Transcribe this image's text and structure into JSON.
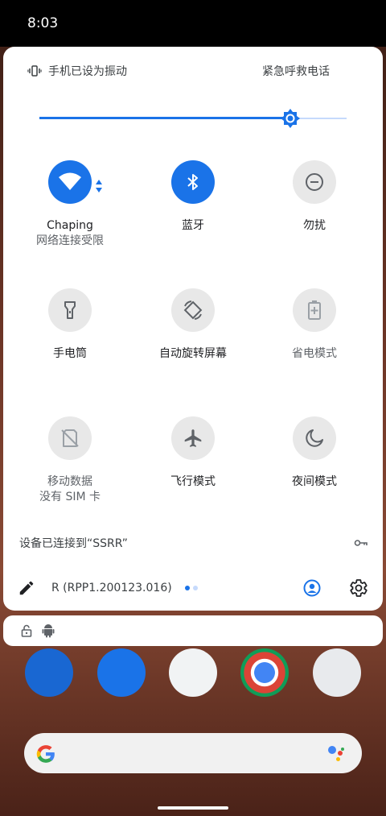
{
  "status_bar": {
    "time": "8:03"
  },
  "quick_settings": {
    "header": {
      "ringer_text": "手机已设为振动",
      "emergency_text": "紧急呼救电话"
    },
    "brightness": {
      "level_percent": 81
    },
    "tiles": [
      {
        "label": "Chaping",
        "sub": "网络连接受限",
        "icon": "wifi-icon",
        "state": "on"
      },
      {
        "label": "蓝牙",
        "sub": "",
        "icon": "bluetooth-icon",
        "state": "on"
      },
      {
        "label": "勿扰",
        "sub": "",
        "icon": "do-not-disturb-icon",
        "state": "off"
      },
      {
        "label": "手电筒",
        "sub": "",
        "icon": "flashlight-icon",
        "state": "off"
      },
      {
        "label": "自动旋转屏幕",
        "sub": "",
        "icon": "auto-rotate-icon",
        "state": "off"
      },
      {
        "label": "省电模式",
        "sub": "",
        "icon": "battery-saver-icon",
        "state": "unavailable"
      },
      {
        "label": "移动数据",
        "sub": "没有 SIM 卡",
        "icon": "mobile-data-off-icon",
        "state": "unavailable"
      },
      {
        "label": "飞行模式",
        "sub": "",
        "icon": "airplane-icon",
        "state": "off"
      },
      {
        "label": "夜间模式",
        "sub": "",
        "icon": "night-mode-icon",
        "state": "off"
      }
    ],
    "vpn": {
      "text": "设备已连接到“SSRR”",
      "icon": "vpn-key-icon"
    },
    "footer": {
      "build": "R (RPP1.200123.016)",
      "page_count": 2,
      "current_page": 1
    }
  },
  "colors": {
    "accent": "#1a73e8",
    "tile_off": "#e8e8e8",
    "panel": "#ffffff"
  },
  "home_screen": {
    "dock_apps": [
      "phone-icon",
      "messages-icon",
      "play-store-icon",
      "chrome-icon",
      "camera-icon"
    ]
  }
}
